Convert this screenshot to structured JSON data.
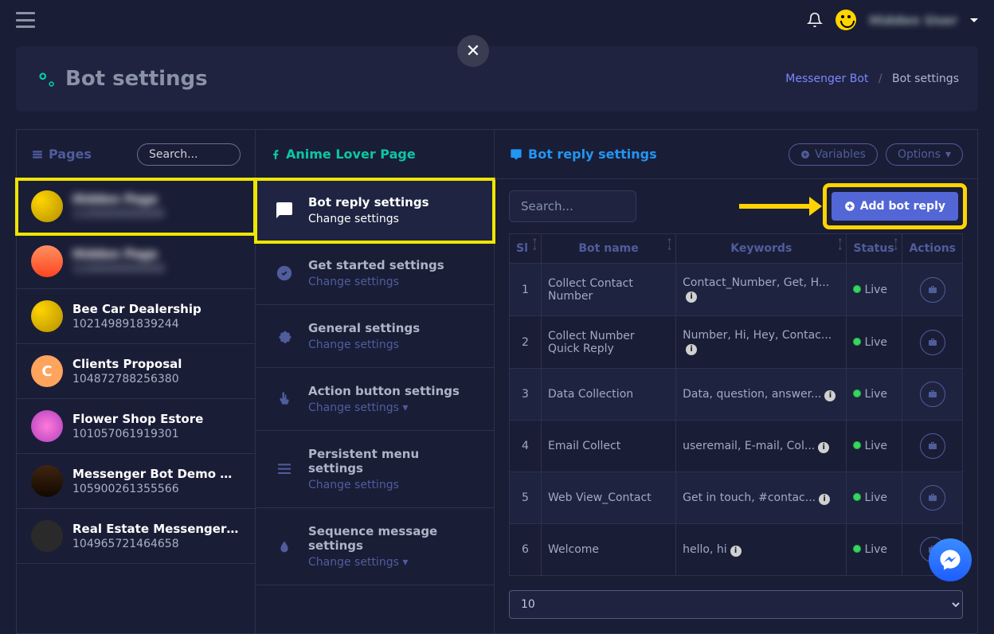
{
  "topbar": {
    "user_name": "Hidden User",
    "dropdown": true
  },
  "header": {
    "title": "Bot settings",
    "breadcrumb_parent": "Messenger Bot",
    "breadcrumb_current": "Bot settings"
  },
  "col1": {
    "title": "Pages",
    "search_placeholder": "Search...",
    "pages": [
      {
        "name": "Hidden Page",
        "sub": "1100000000000",
        "ava": "y",
        "selected": true,
        "blur": true
      },
      {
        "name": "Hidden Page",
        "sub": "1100000000000",
        "ava": "o",
        "blur": true
      },
      {
        "name": "Bee Car Dealership",
        "sub": "102149891839244",
        "ava": "y"
      },
      {
        "name": "Clients Proposal",
        "sub": "104872788256380",
        "ava": "c",
        "letter": "C"
      },
      {
        "name": "Flower Shop Estore",
        "sub": "101057061919301",
        "ava": "p"
      },
      {
        "name": "Messenger Bot Demo Restaurant",
        "sub": "105900261355566",
        "ava": "d"
      },
      {
        "name": "Real Estate Messenger Bot",
        "sub": "104965721464658",
        "ava": "g"
      }
    ]
  },
  "col2": {
    "title": "Anime Lover Page",
    "items": [
      {
        "title": "Bot reply settings",
        "link": "Change settings",
        "icon": "chat",
        "selected": true
      },
      {
        "title": "Get started settings",
        "link": "Change settings",
        "icon": "check"
      },
      {
        "title": "General settings",
        "link": "Change settings",
        "icon": "gear"
      },
      {
        "title": "Action button settings",
        "link": "Change settings",
        "icon": "pointer",
        "caret": true
      },
      {
        "title": "Persistent menu settings",
        "link": "Change settings",
        "icon": "menu"
      },
      {
        "title": "Sequence message settings",
        "link": "Change settings",
        "icon": "drop",
        "caret": true
      }
    ]
  },
  "col3": {
    "title": "Bot reply settings",
    "variables_btn": "Variables",
    "options_btn": "Options",
    "search_placeholder": "Search...",
    "add_btn": "Add bot reply",
    "columns": {
      "sl": "Sl",
      "name": "Bot name",
      "kw": "Keywords",
      "status": "Status",
      "actions": "Actions"
    },
    "rows": [
      {
        "sl": "1",
        "name": "Collect Contact Number",
        "kw": "Contact_Number, Get, H...",
        "info": true,
        "status": "Live"
      },
      {
        "sl": "2",
        "name": "Collect Number Quick Reply",
        "kw": "Number, Hi, Hey, Contac...",
        "info": true,
        "status": "Live"
      },
      {
        "sl": "3",
        "name": "Data Collection",
        "kw": "Data, question, answer...",
        "info": true,
        "status": "Live"
      },
      {
        "sl": "4",
        "name": "Email Collect",
        "kw": "useremail, E-mail, Col...",
        "info": true,
        "status": "Live"
      },
      {
        "sl": "5",
        "name": "Web View_Contact",
        "kw": "Get in touch, #contac...",
        "info": true,
        "status": "Live"
      },
      {
        "sl": "6",
        "name": "Welcome",
        "kw": "hello, hi",
        "info": true,
        "status": "Live"
      }
    ],
    "page_size": "10"
  }
}
